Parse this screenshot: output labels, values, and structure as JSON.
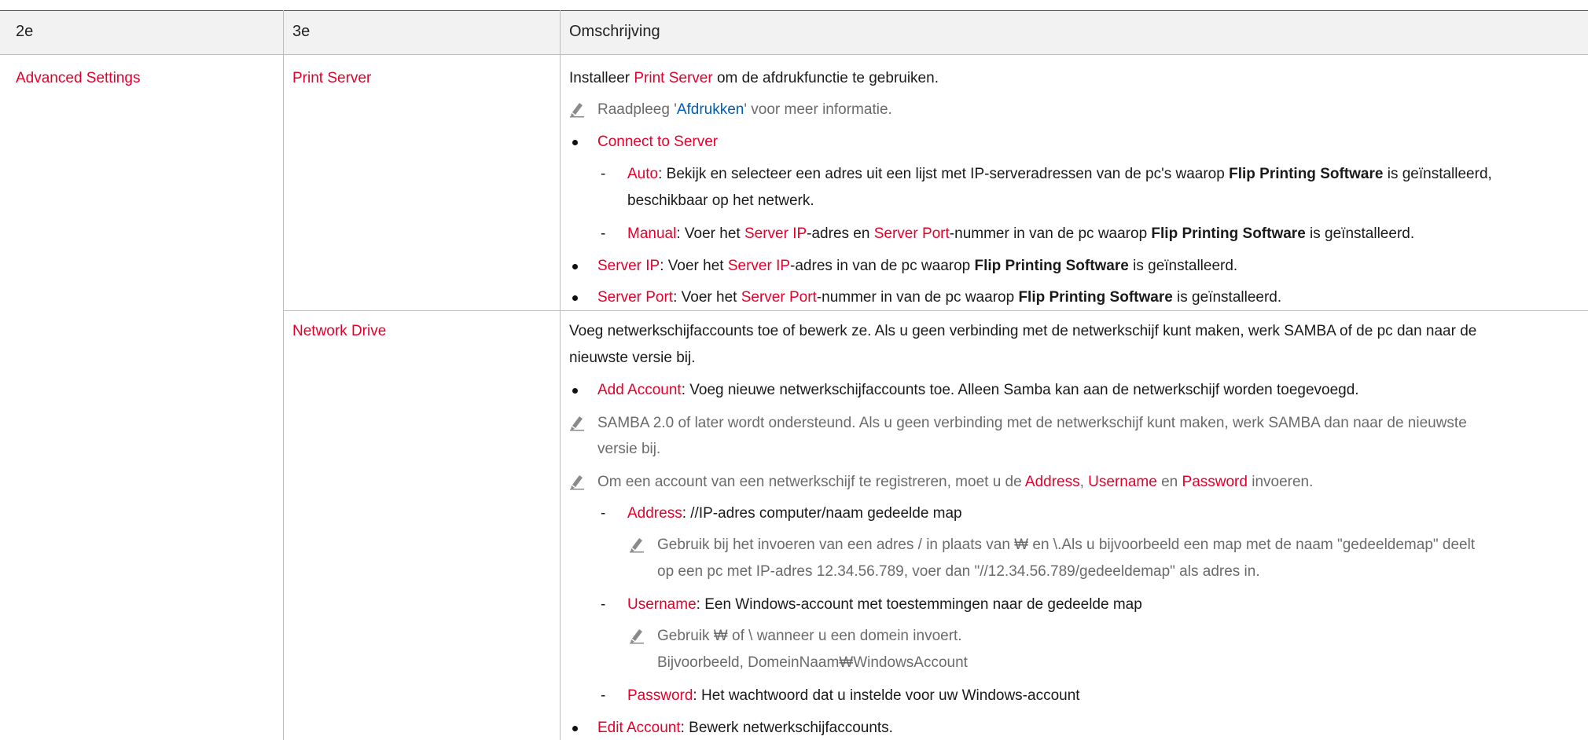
{
  "table": {
    "headers": [
      "2e",
      "3e",
      "Omschrijving"
    ],
    "col2_value": "Advanced Settings",
    "rows": [
      {
        "col3": "Print Server"
      },
      {
        "col3": "Network Drive"
      }
    ]
  },
  "print_server": {
    "intro_pre": "Installeer ",
    "intro_red": "Print Server",
    "intro_post": " om de afdrukfunctie te gebruiken.",
    "note_pre": "Raadpleeg '",
    "note_link": "Afdrukken",
    "note_post": "' voor meer informatie.",
    "connect_to_server": "Connect to Server",
    "auto_label": "Auto",
    "auto_text_1": ": Bekijk en selecteer een adres uit een lijst met IP-serveradressen van de pc's waarop ",
    "flip_software": "Flip Printing Software",
    "auto_text_2": " is geïnstalleerd,",
    "auto_text_3": "beschikbaar op het netwerk.",
    "manual_label": "Manual",
    "manual_text_1": ": Voer het ",
    "server_ip": "Server IP",
    "manual_text_2": "-adres en ",
    "server_port": "Server Port",
    "manual_text_3": "-nummer in van de pc waarop ",
    "installed": " is geïnstalleerd.",
    "serverip_text_1": ": Voer het ",
    "serverip_text_2": "-adres in van de pc waarop ",
    "serverport_text_1": ": Voer het ",
    "serverport_text_2": "-nummer in van de pc waarop "
  },
  "network_drive": {
    "intro_1": "Voeg netwerkschijfaccounts toe of bewerk ze. Als u geen verbinding met de netwerkschijf kunt maken, werk SAMBA of de pc dan naar de",
    "intro_2": "nieuwste versie bij.",
    "add_account": "Add Account",
    "add_account_text": ": Voeg nieuwe netwerkschijfaccounts toe. Alleen Samba kan aan de netwerkschijf worden toegevoegd.",
    "note1_1": "SAMBA 2.0 of later wordt ondersteund. Als u geen verbinding met de netwerkschijf kunt maken, werk SAMBA dan naar de nieuwste",
    "note1_2": "versie bij.",
    "note2_pre": "Om een account van een netwerkschijf te registreren, moet u de ",
    "address": "Address",
    "comma": ", ",
    "username": "Username",
    "and": " en ",
    "password": "Password",
    "note2_post": " invoeren.",
    "address_text": ": //IP-adres computer/naam gedeelde map",
    "address_note_1": "Gebruik bij het invoeren van een adres / in plaats van ₩ en \\.Als u bijvoorbeeld een map met de naam \"gedeeldemap\" deelt",
    "address_note_2": "op een pc met IP-adres 12.34.56.789, voer dan \"//12.34.56.789/gedeeldemap\" als adres in.",
    "username_text": ": Een Windows-account met toestemmingen naar de gedeelde map",
    "username_note_1": "Gebruik ₩ of \\ wanneer u een domein invoert.",
    "username_note_2": "Bijvoorbeeld, DomeinNaam₩WindowsAccount",
    "password_text": ": Het wachtwoord dat u instelde voor uw Windows-account",
    "edit_account": "Edit Account",
    "edit_account_text": ": Bewerk netwerkschijfaccounts."
  }
}
